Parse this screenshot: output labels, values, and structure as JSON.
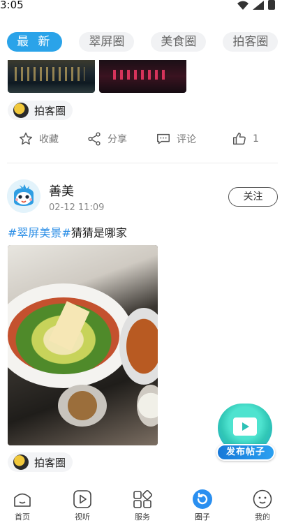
{
  "status_bar": {
    "time": "3:05"
  },
  "tabs": [
    {
      "label": "最 新",
      "active": true
    },
    {
      "label": "翠屏圈",
      "active": false
    },
    {
      "label": "美食圈",
      "active": false
    },
    {
      "label": "拍客圈",
      "active": false
    }
  ],
  "previous_post": {
    "circle_tag": "拍客圈",
    "actions": {
      "collect": "收藏",
      "share": "分享",
      "comment": "评论",
      "like_count": "1"
    }
  },
  "post": {
    "author": "善美",
    "time": "02-12 11:09",
    "follow_label": "关注",
    "hashtag": "#翠屏美景#",
    "text": "猜猜是哪家",
    "circle_tag": "拍客圈"
  },
  "fab": {
    "label": "发布帖子"
  },
  "bottom_nav": [
    {
      "label": "首页"
    },
    {
      "label": "视听"
    },
    {
      "label": "服务"
    },
    {
      "label": "圈子",
      "active": true
    },
    {
      "label": "我的"
    }
  ],
  "colors": {
    "accent": "#2aa3e9",
    "hashtag": "#2b8ee6"
  }
}
